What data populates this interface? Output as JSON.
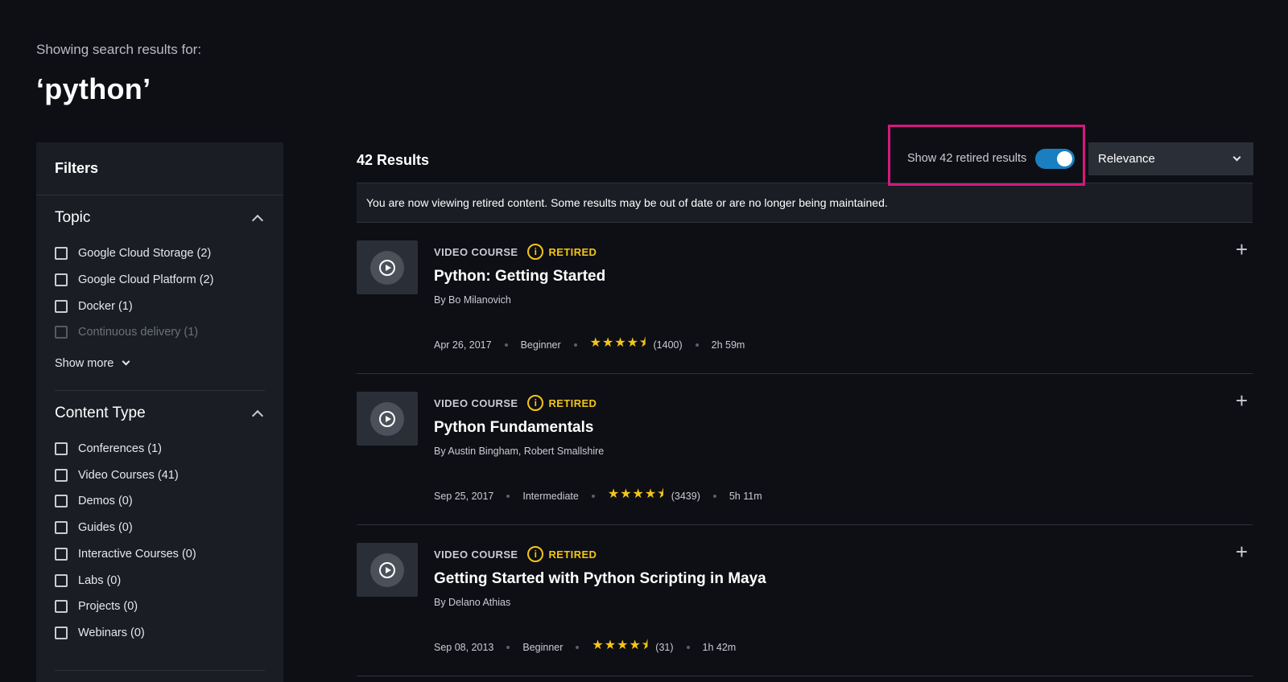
{
  "header": {
    "subtitle": "Showing search results for:",
    "query": "‘python’"
  },
  "filters": {
    "title": "Filters",
    "topic": {
      "title": "Topic",
      "items": [
        {
          "label": "Google Cloud Storage (2)"
        },
        {
          "label": "Google Cloud Platform (2)"
        },
        {
          "label": "Docker (1)"
        },
        {
          "label": "Continuous delivery (1)"
        }
      ],
      "show_more": "Show more"
    },
    "content_type": {
      "title": "Content Type",
      "items": [
        {
          "label": "Conferences (1)"
        },
        {
          "label": "Video Courses (41)"
        },
        {
          "label": "Demos (0)"
        },
        {
          "label": "Guides (0)"
        },
        {
          "label": "Interactive Courses (0)"
        },
        {
          "label": "Labs (0)"
        },
        {
          "label": "Projects (0)"
        },
        {
          "label": "Webinars (0)"
        }
      ]
    }
  },
  "results_bar": {
    "count": "42 Results",
    "retired_toggle_label": "Show 42 retired results",
    "retired_toggle_on": true,
    "sort_value": "Relevance",
    "notice": "You are now viewing retired content. Some results may be out of date or are no longer being maintained."
  },
  "colors": {
    "accent_toggle": "#1a7fc1",
    "retired_badge": "#f5c518",
    "highlight_box": "#d4187f"
  },
  "results": [
    {
      "type": "VIDEO COURSE",
      "status": "RETIRED",
      "title": "Python: Getting Started",
      "author": "By Bo Milanovich",
      "date": "Apr 26, 2017",
      "level": "Beginner",
      "rating": 4.5,
      "stars": "★★★★⯨",
      "reviews": "(1400)",
      "duration": "2h 59m"
    },
    {
      "type": "VIDEO COURSE",
      "status": "RETIRED",
      "title": "Python Fundamentals",
      "author": "By Austin Bingham, Robert Smallshire",
      "date": "Sep 25, 2017",
      "level": "Intermediate",
      "rating": 4.5,
      "stars": "★★★★⯨",
      "reviews": "(3439)",
      "duration": "5h 11m"
    },
    {
      "type": "VIDEO COURSE",
      "status": "RETIRED",
      "title": "Getting Started with Python Scripting in Maya",
      "author": "By Delano Athias",
      "date": "Sep 08, 2013",
      "level": "Beginner",
      "rating": 4.5,
      "stars": "★★★★⯨",
      "reviews": "(31)",
      "duration": "1h 42m"
    }
  ]
}
